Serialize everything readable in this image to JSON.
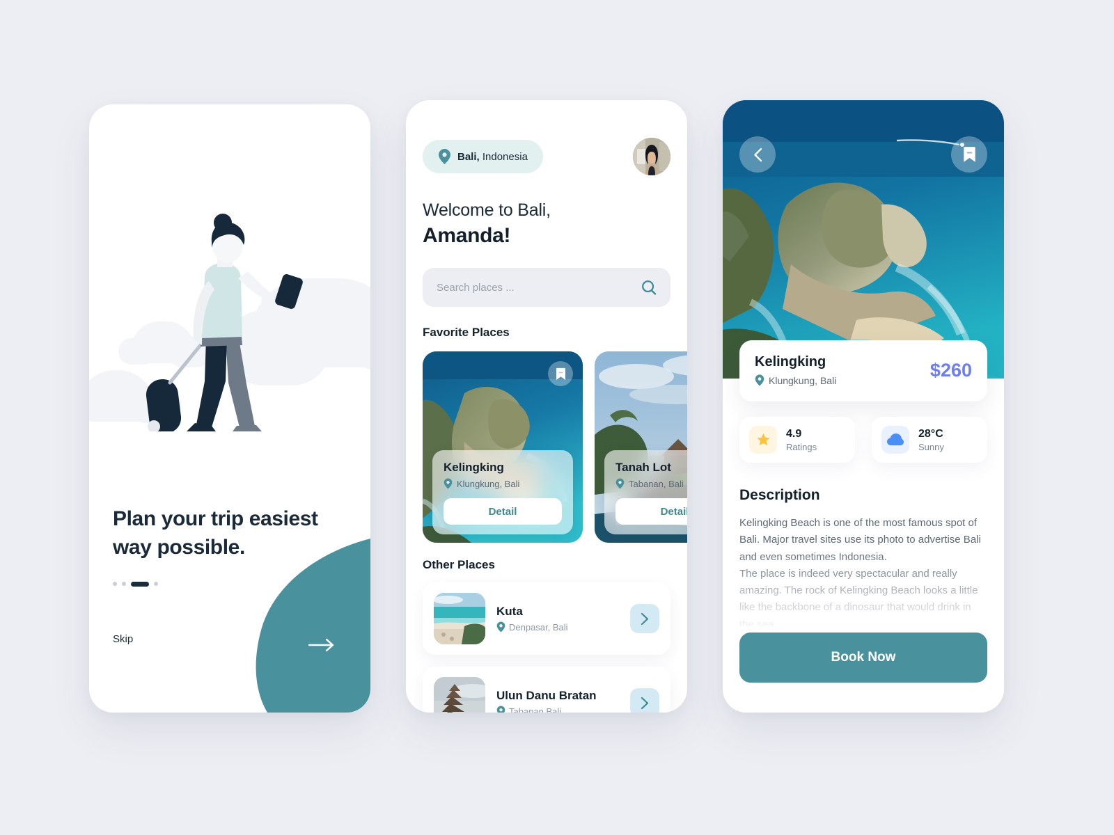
{
  "theme": {
    "page_bg": "#edeef3",
    "teal": "#4a919e",
    "teal_dark": "#3d8a95",
    "ink": "#13202c",
    "price_blue": "#6c7ef2",
    "star_yellow": "#fcc43e",
    "star_bg": "#fef6e0",
    "cloud_blue": "#4b8ef5",
    "cloud_bg": "#eaf1fe",
    "chev_bg": "#d3eaf4",
    "pill_bg": "#e2f0ef"
  },
  "onboarding": {
    "title": "Plan your trip easiest way possible.",
    "skip_label": "Skip",
    "next_icon": "arrow-right-icon",
    "illustration": "traveler-with-suitcase-illustration",
    "pagination": {
      "total": 4,
      "active_index": 2
    }
  },
  "home": {
    "location": {
      "city": "Bali,",
      "country": " Indonesia",
      "icon": "map-pin-icon"
    },
    "avatar": "user-avatar",
    "welcome_line_1": "Welcome to Bali,",
    "welcome_line_2": "Amanda!",
    "search": {
      "placeholder": "Search places ...",
      "value": "",
      "icon": "search-icon"
    },
    "favorite_section_title": "Favorite Places",
    "favorites": [
      {
        "name": "Kelingking",
        "location": "Klungkung, Bali",
        "detail_label": "Detail",
        "bookmark_icon": "bookmark-icon",
        "image": "kelingking-beach-cliff-photo"
      },
      {
        "name": "Tanah Lot",
        "location": "Tabanan, Bali",
        "detail_label": "Detail",
        "bookmark_icon": "bookmark-icon",
        "image": "tanah-lot-temple-photo"
      }
    ],
    "other_section_title": "Other Places",
    "other_places": [
      {
        "name": "Kuta",
        "location": "Denpasar, Bali",
        "image": "kuta-beach-photo",
        "chevron_icon": "chevron-right-icon"
      },
      {
        "name": "Ulun Danu Bratan",
        "location": "Tabanan Bali",
        "image": "ulun-danu-bratan-temple-photo",
        "chevron_icon": "chevron-right-icon"
      }
    ]
  },
  "detail": {
    "back_icon": "chevron-left-icon",
    "bookmark_icon": "bookmark-icon",
    "hero_image": "kelingking-beach-aerial-photo",
    "place_name": "Kelingking",
    "place_location": "Klungkung, Bali",
    "price": "$260",
    "stats": [
      {
        "icon": "star-icon",
        "value": "4.9",
        "label": "Ratings"
      },
      {
        "icon": "cloud-icon",
        "value": "28°C",
        "label": "Sunny"
      }
    ],
    "description_title": "Description",
    "description_body": "Kelingking Beach is one of the most famous spot of Bali. Major travel sites use its photo to advertise Bali and even sometimes Indonesia.\nThe place is indeed very spectacular and really amazing. The rock of Kelingking Beach looks a little like the backbone of a dinosaur that would drink in the sea.",
    "book_label": "Book Now"
  }
}
